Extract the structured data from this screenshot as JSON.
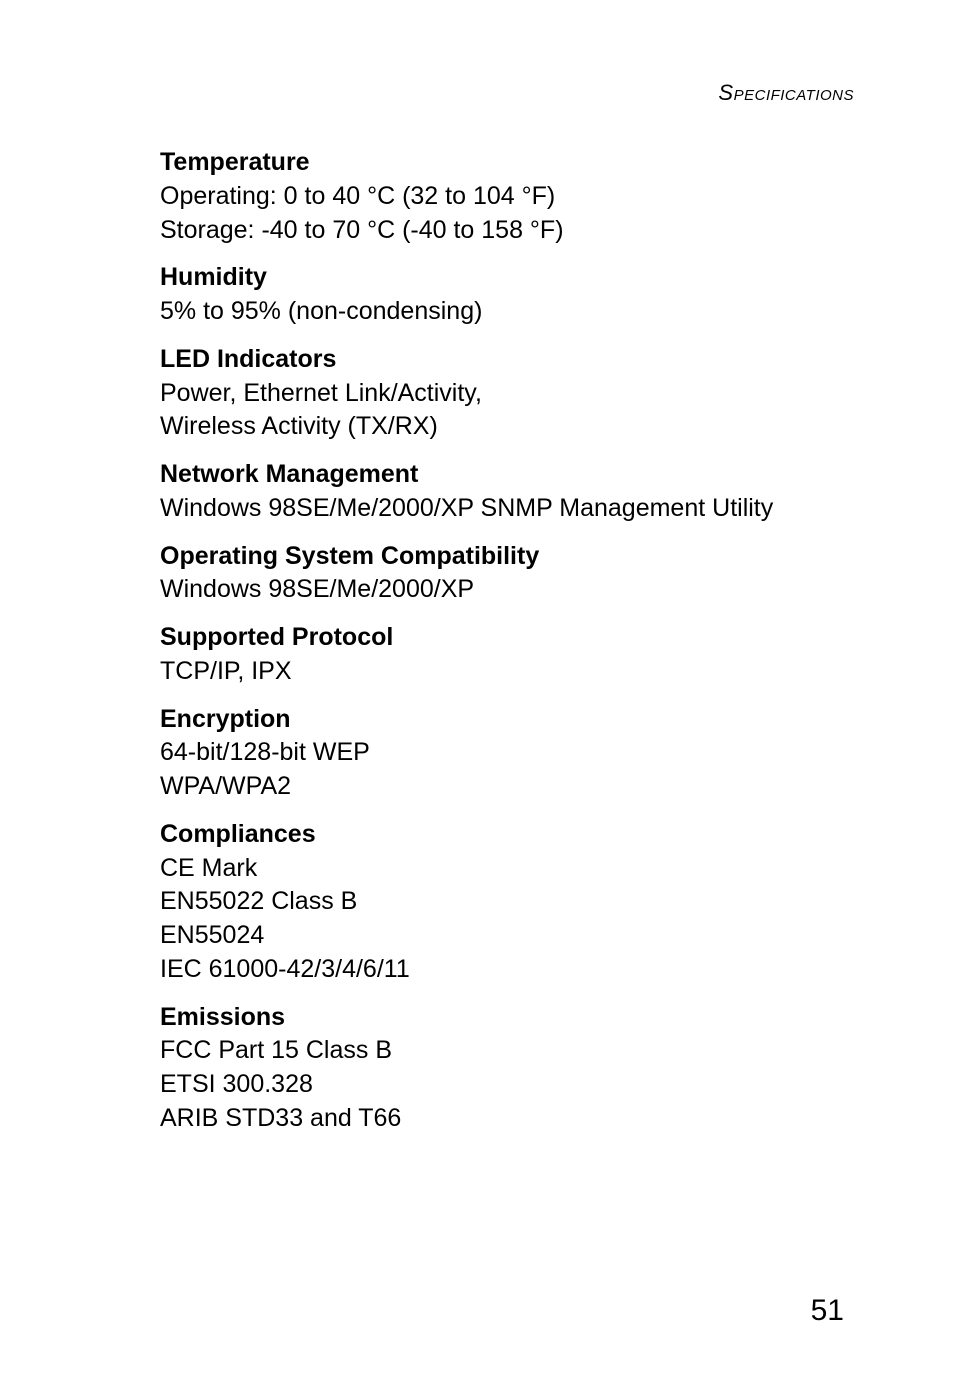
{
  "header": {
    "label": "Specifications"
  },
  "sections": [
    {
      "heading": "Temperature",
      "lines": [
        "Operating: 0 to 40 °C (32 to 104 °F)",
        "Storage: -40 to 70 °C (-40 to 158 °F)"
      ]
    },
    {
      "heading": "Humidity",
      "lines": [
        "5% to 95% (non-condensing)"
      ]
    },
    {
      "heading": "LED Indicators",
      "lines": [
        "Power, Ethernet Link/Activity,",
        "Wireless Activity (TX/RX)"
      ]
    },
    {
      "heading": "Network Management",
      "lines": [
        "Windows 98SE/Me/2000/XP SNMP Management Utility"
      ]
    },
    {
      "heading": "Operating System Compatibility",
      "lines": [
        "Windows 98SE/Me/2000/XP"
      ]
    },
    {
      "heading": "Supported Protocol",
      "lines": [
        "TCP/IP, IPX"
      ]
    },
    {
      "heading": "Encryption",
      "lines": [
        "64-bit/128-bit WEP",
        "WPA/WPA2"
      ]
    },
    {
      "heading": "Compliances",
      "lines": [
        "CE Mark",
        "EN55022 Class B",
        "EN55024",
        "IEC 61000-42/3/4/6/11"
      ]
    },
    {
      "heading": "Emissions",
      "lines": [
        "FCC Part 15 Class B",
        "ETSI 300.328",
        "ARIB STD33 and T66"
      ]
    }
  ],
  "page_number": "51"
}
